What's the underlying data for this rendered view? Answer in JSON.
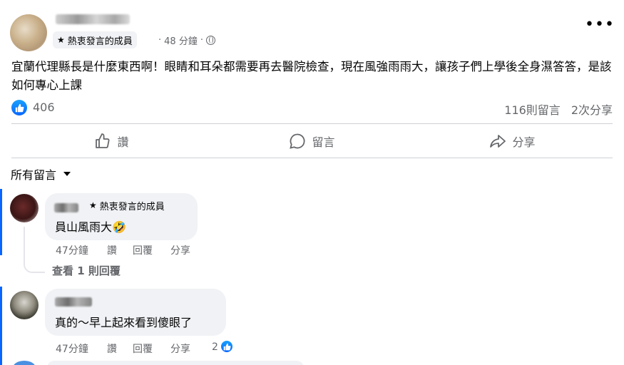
{
  "post": {
    "badge_label": "熱衷發言的成員",
    "time": "48 分鐘",
    "separator": "·",
    "text": "宜蘭代理縣長是什麼東西啊！眼睛和耳朵都需要再去醫院檢查，現在風強雨雨大，讓孩子們上學後全身濕答答，是該如何專心上課",
    "like_count": "406",
    "comments_count": "116則留言",
    "shares_count": "2次分享",
    "more_label": "•••"
  },
  "actions": {
    "like": "讚",
    "comment": "留言",
    "share": "分享"
  },
  "comments_filter": "所有留言",
  "comments": [
    {
      "badge_label": "熱衷發言的成員",
      "text": "員山風雨大🤣",
      "time": "47分鐘",
      "like": "讚",
      "reply": "回覆",
      "share": "分享",
      "view_replies": "查看 1 則回覆"
    },
    {
      "text": "真的～早上起來看到傻眼了",
      "time": "47分鐘",
      "like": "讚",
      "reply": "回覆",
      "share": "分享",
      "reaction_count": "2"
    }
  ],
  "colors": {
    "accent": "#0866ff",
    "secondary_text": "#65676b",
    "bubble_bg": "#f0f2f5"
  }
}
